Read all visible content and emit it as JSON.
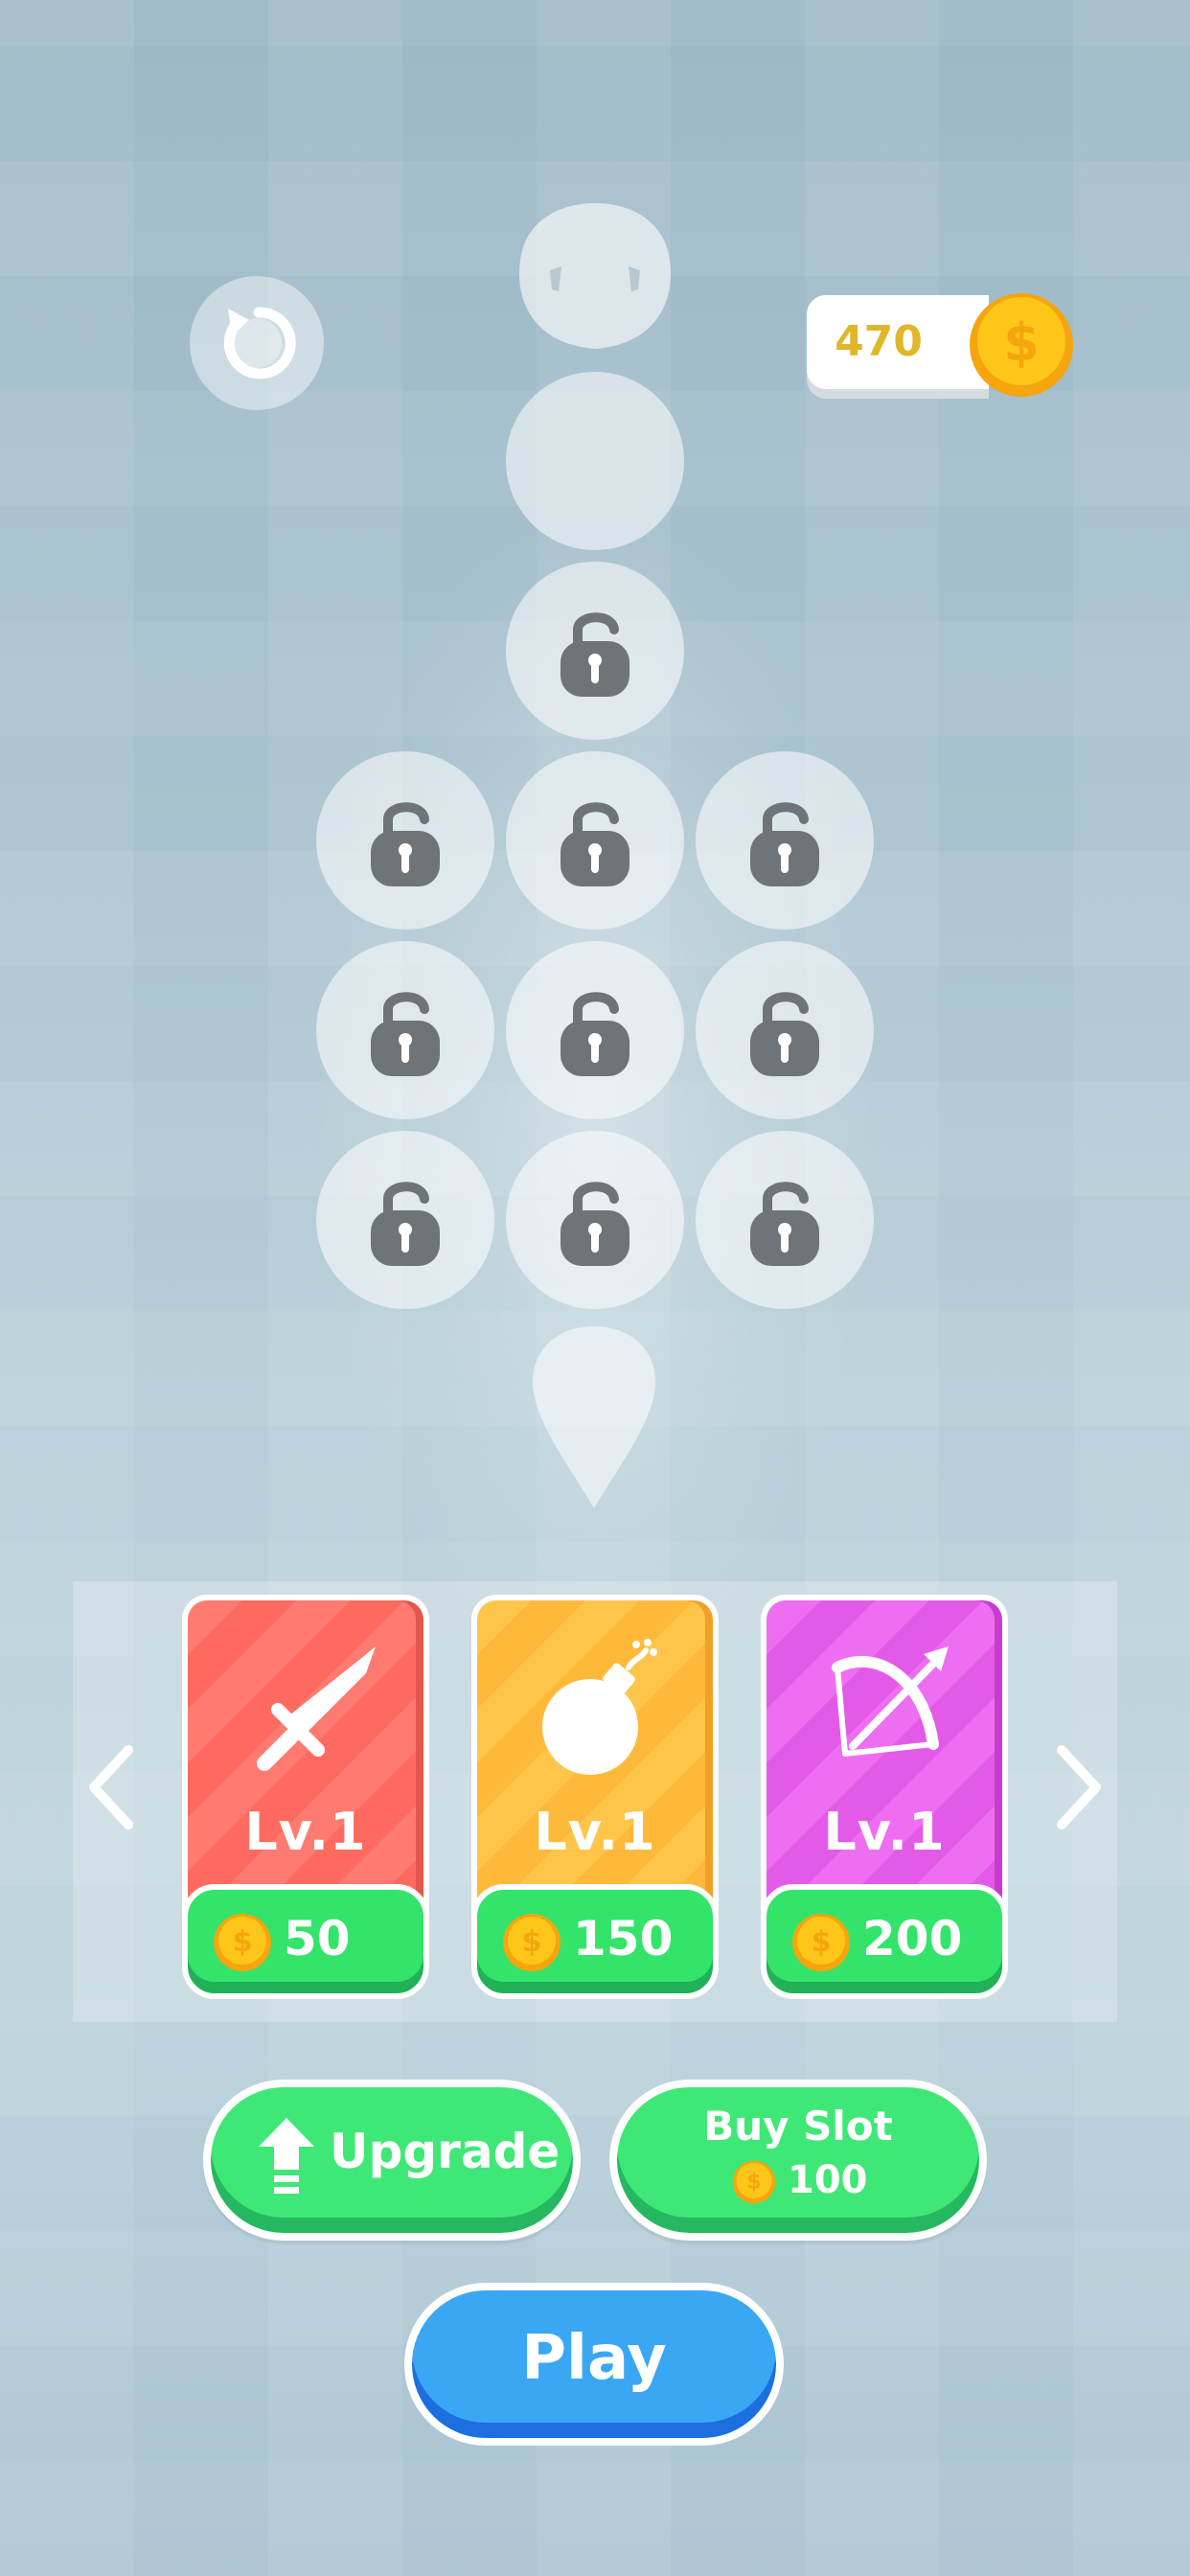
{
  "hud": {
    "coins": "470",
    "accent_gold": "#f5b80e"
  },
  "snake": {
    "slots": [
      {
        "locked": true
      },
      {
        "locked": true
      },
      {
        "locked": true
      },
      {
        "locked": true
      },
      {
        "locked": true
      },
      {
        "locked": true
      },
      {
        "locked": true
      },
      {
        "locked": true
      },
      {
        "locked": true
      },
      {
        "locked": true
      }
    ]
  },
  "shop": {
    "cards": [
      {
        "item": "sword-icon",
        "level": "Lv.1",
        "price": "50",
        "color": "#ff7a70"
      },
      {
        "item": "bomb-icon",
        "level": "Lv.1",
        "price": "150",
        "color": "#ffc54a"
      },
      {
        "item": "bow-icon",
        "level": "Lv.1",
        "price": "200",
        "color": "#ee6ef2"
      }
    ]
  },
  "buttons": {
    "upgrade": "Upgrade",
    "buy_slot": "Buy Slot",
    "buy_slot_price": "100",
    "play": "Play"
  }
}
